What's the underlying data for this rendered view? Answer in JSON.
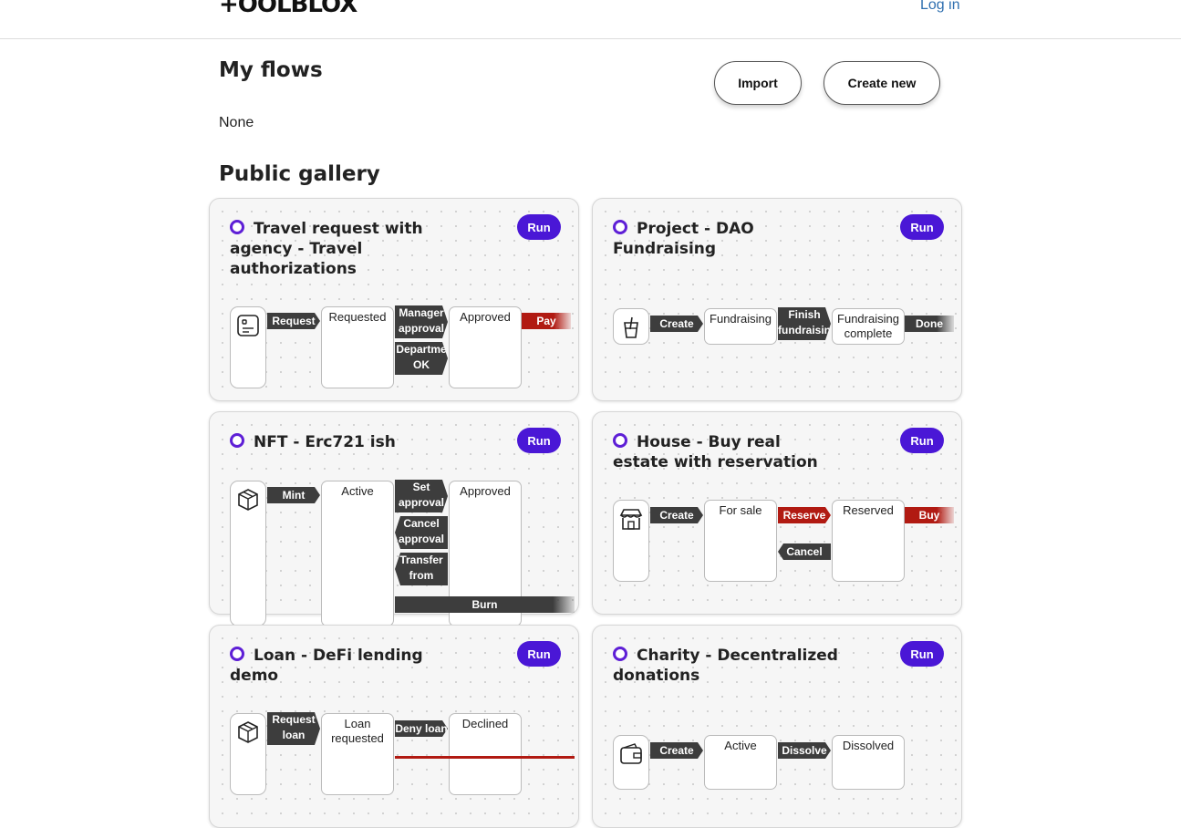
{
  "header": {
    "logo": "+OOLBLOX",
    "login": "Log in"
  },
  "my_flows": {
    "title": "My flows",
    "import_label": "Import",
    "create_label": "Create new",
    "empty_text": "None"
  },
  "gallery": {
    "title": "Public gallery",
    "run_label": "Run",
    "cards": [
      {
        "title": "Travel request with agency - Travel authorizations",
        "states": [
          "Requested",
          "Approved"
        ],
        "transitions": [
          "Request",
          "Manager approval",
          "Departme OK",
          "Pay"
        ]
      },
      {
        "title": "Project - DAO Fundraising",
        "states": [
          "Fundraising",
          "Fundraising complete"
        ],
        "transitions": [
          "Create",
          "Finish fundraisin",
          "Done"
        ]
      },
      {
        "title": "NFT - Erc721 ish",
        "states": [
          "Active",
          "Approved"
        ],
        "transitions": [
          "Mint",
          "Set approval",
          "Cancel approval",
          "Transfer from",
          "Burn"
        ]
      },
      {
        "title": "House - Buy real estate with reservation",
        "states": [
          "For sale",
          "Reserved"
        ],
        "transitions": [
          "Create",
          "Reserve",
          "Cancel",
          "Buy"
        ]
      },
      {
        "title": "Loan - DeFi lending demo",
        "states": [
          "Loan requested",
          "Declined"
        ],
        "transitions": [
          "Request loan",
          "Deny loan"
        ]
      },
      {
        "title": "Charity - Decentralized donations",
        "states": [
          "Active",
          "Dissolved"
        ],
        "transitions": [
          "Create",
          "Dissolve"
        ]
      }
    ]
  },
  "colors": {
    "accent": "#4a17d6",
    "arrow_dark": "#3d3d3d",
    "arrow_red": "#b11a12",
    "link": "#2f6fb0"
  },
  "icons": [
    "form-icon",
    "drink-icon",
    "package-icon",
    "store-icon",
    "wallet-icon"
  ]
}
